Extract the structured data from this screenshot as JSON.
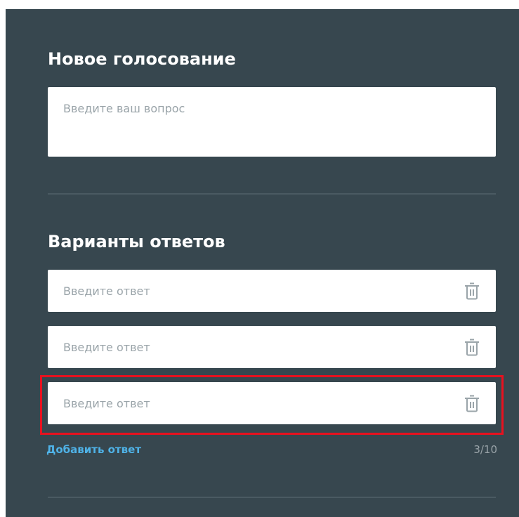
{
  "poll": {
    "title": "Новое голосование",
    "question_placeholder": "Введите ваш вопрос",
    "question_value": ""
  },
  "answers": {
    "title": "Варианты ответов",
    "items": [
      {
        "placeholder": "Введите ответ",
        "value": "",
        "delete_icon": "trash-icon"
      },
      {
        "placeholder": "Введите ответ",
        "value": "",
        "delete_icon": "trash-icon"
      },
      {
        "placeholder": "Введите ответ",
        "value": "",
        "delete_icon": "trash-icon"
      }
    ],
    "add_label": "Добавить ответ",
    "counter": "3/10"
  },
  "colors": {
    "panel_bg": "#37474f",
    "accent_link": "#4fb3e8",
    "highlight": "#e8111f",
    "muted_text": "#9aa4a9"
  }
}
